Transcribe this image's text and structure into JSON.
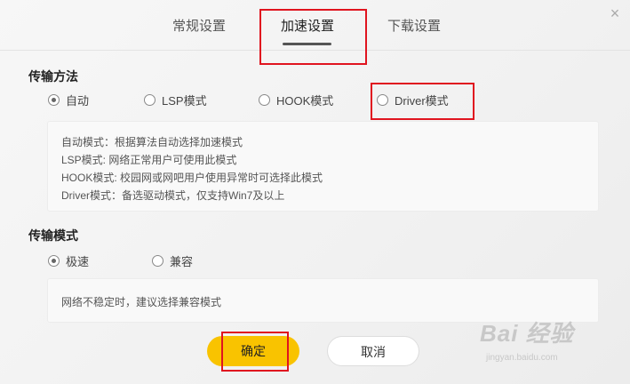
{
  "tabs": [
    {
      "label": "常规设置"
    },
    {
      "label": "加速设置"
    },
    {
      "label": "下载设置"
    }
  ],
  "close_glyph": "×",
  "transfer_method": {
    "title": "传输方法",
    "options": [
      {
        "label": "自动",
        "selected": true
      },
      {
        "label": "LSP模式",
        "selected": false
      },
      {
        "label": "HOOK模式",
        "selected": false
      },
      {
        "label": "Driver模式",
        "selected": false
      }
    ],
    "descriptions": [
      "自动模式：根据算法自动选择加速模式",
      "LSP模式: 网络正常用户可使用此模式",
      "HOOK模式: 校园网或网吧用户使用异常时可选择此模式",
      "Driver模式：备选驱动模式，仅支持Win7及以上"
    ]
  },
  "transfer_mode": {
    "title": "传输模式",
    "options": [
      {
        "label": "极速",
        "selected": true
      },
      {
        "label": "兼容",
        "selected": false
      }
    ],
    "description": "网络不稳定时，建议选择兼容模式"
  },
  "buttons": {
    "ok": "确定",
    "cancel": "取消"
  },
  "watermark": {
    "title": "Bai 经验",
    "subtitle": "jingyan.baidu.com"
  },
  "colors": {
    "accent": "#f9c300",
    "highlight_box": "#e0141f"
  }
}
